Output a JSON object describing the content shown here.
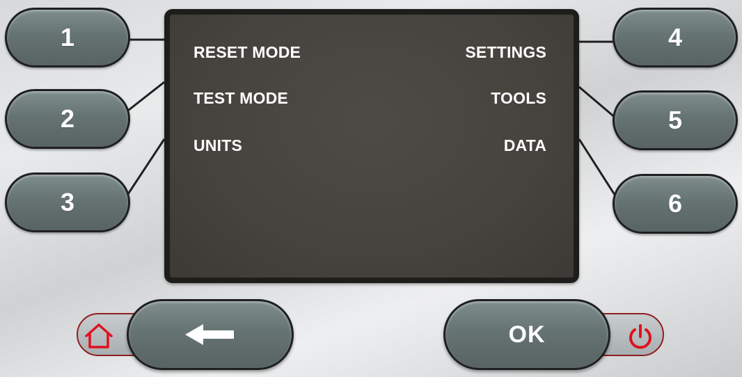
{
  "screen": {
    "menu_left": [
      "RESET MODE",
      "TEST MODE",
      "UNITS"
    ],
    "menu_right": [
      "SETTINGS",
      "TOOLS",
      "DATA"
    ]
  },
  "softkeys": {
    "left": [
      "1",
      "2",
      "3"
    ],
    "right": [
      "4",
      "5",
      "6"
    ]
  },
  "nav": {
    "ok_label": "OK",
    "back_icon": "left-arrow-icon",
    "home_icon": "home-icon",
    "power_icon": "power-icon"
  },
  "colors": {
    "button": "#667373",
    "lcd": "#46423d",
    "accent_red": "#e0101e"
  }
}
